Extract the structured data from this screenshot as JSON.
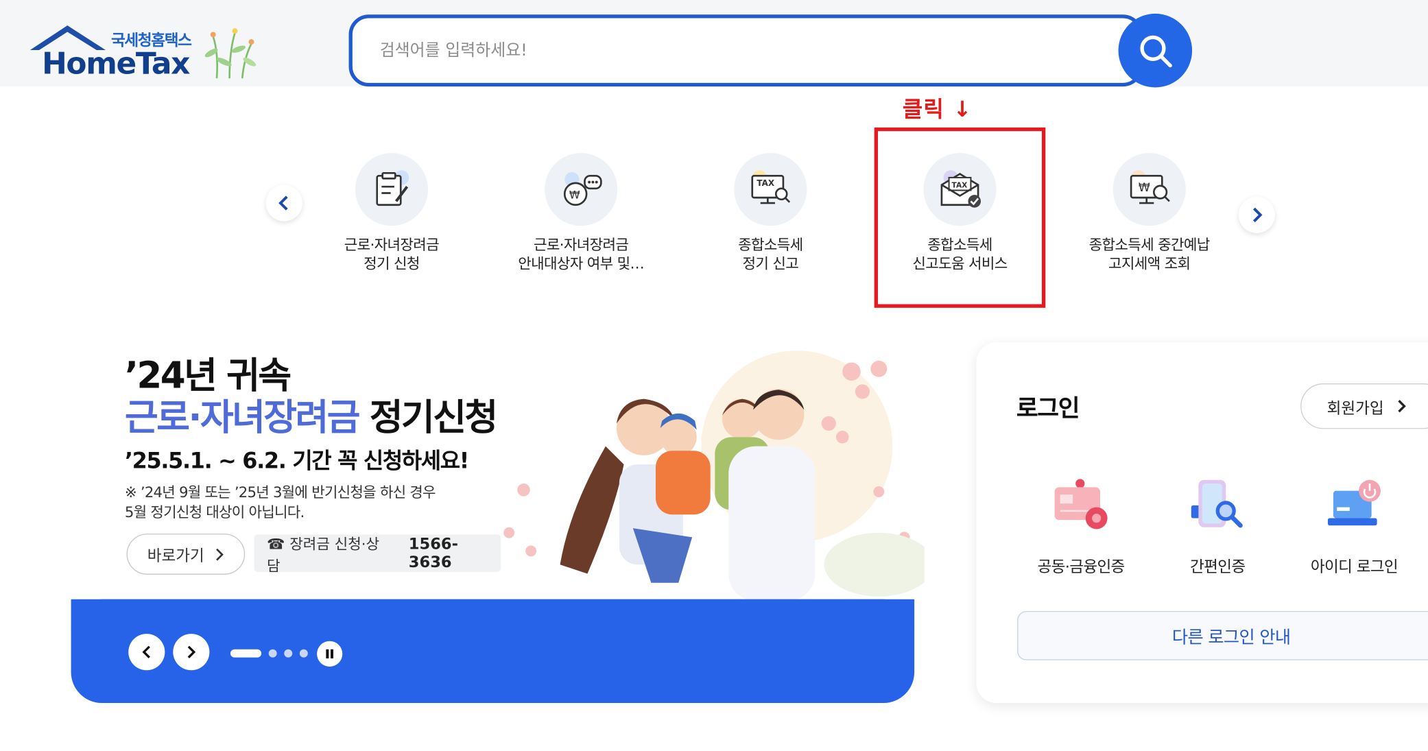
{
  "header": {
    "logo_korean": "국세청홈택스",
    "logo_english": "HomeTax",
    "search_placeholder": "검색어를 입력하세요!"
  },
  "annotation": {
    "click_label": "클릭 ↓",
    "highlight_color": "#e6191f"
  },
  "services": [
    {
      "label": "근로·자녀장려금\n정기 신청",
      "icon": "form-pen-icon"
    },
    {
      "label": "근로·자녀장려금\n안내대상자 여부 및…",
      "icon": "chat-won-icon"
    },
    {
      "label": "종합소득세\n정기 신고",
      "icon": "tax-monitor-icon"
    },
    {
      "label": "종합소득세\n신고도움 서비스",
      "icon": "tax-envelope-check-icon"
    },
    {
      "label": "종합소득세 중간예납\n고지세액 조회",
      "icon": "won-monitor-search-icon"
    }
  ],
  "banner": {
    "title_line1": "’24년 귀속",
    "title_highlight": "근로·자녀장려금",
    "title_rest": " 정기신청",
    "date_text": "’25.5.1. ~ 6.2. 기간 꼭 신청하세요!",
    "note": "※ ’24년 9월 또는 ’25년 3월에 반기신청을 하신 경우\n    5월 정기신청 대상이 아닙니다.",
    "go_button": "바로가기",
    "phone_label": "☎ 장려금 신청·상담",
    "phone_number": "1566-3636"
  },
  "login": {
    "title": "로그인",
    "signup_label": "회원가입",
    "options": [
      {
        "label": "공동·금융인증",
        "icon": "certificate-card-icon"
      },
      {
        "label": "간편인증",
        "icon": "phone-search-icon"
      },
      {
        "label": "아이디 로그인",
        "icon": "laptop-power-icon"
      }
    ],
    "other_login_label": "다른 로그인 안내"
  },
  "colors": {
    "primary_blue": "#2663e8",
    "search_border": "#1f5ad2",
    "highlight_title": "#4f6bd8",
    "annotation_red": "#e21b1b"
  }
}
